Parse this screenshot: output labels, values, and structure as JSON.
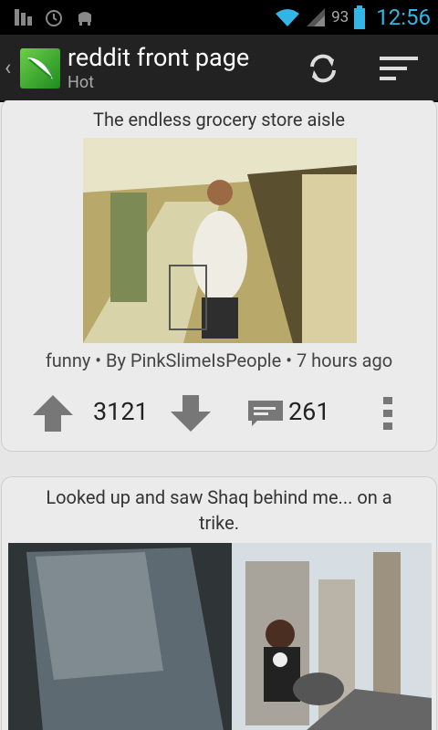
{
  "status_bar": {
    "battery_percent": "93",
    "time": "12:56",
    "icons": [
      "signal-bars-icon",
      "alarm-icon",
      "android-mascot-icon",
      "wifi-icon",
      "cell-signal-icon",
      "battery-icon"
    ]
  },
  "action_bar": {
    "title": "reddit front page",
    "subtitle": "Hot",
    "icons": [
      "back-chevron-icon",
      "reddit-app-logo",
      "refresh-icon",
      "sort-icon"
    ]
  },
  "posts": [
    {
      "title": "The endless grocery store aisle",
      "meta": "funny • By PinkSlimeIsPeople • 7 hours ago",
      "score": "3121",
      "comments": "261"
    },
    {
      "title": "Looked up and saw Shaq behind me... on a trike."
    }
  ],
  "colors": {
    "accent": "#33b5e5",
    "card": "#ebebeb",
    "background": "#e6e6e6",
    "actionbar": "#222222"
  }
}
